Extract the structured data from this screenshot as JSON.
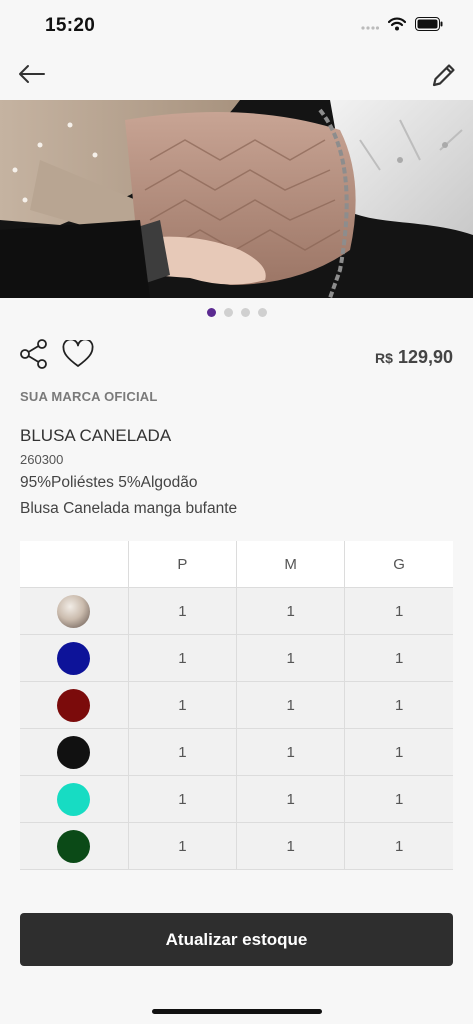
{
  "status_bar": {
    "time": "15:20",
    "icons": [
      "signal-icon",
      "wifi-icon",
      "battery-icon"
    ]
  },
  "nav": {
    "icons": [
      "back-arrow-icon",
      "edit-pencil-icon"
    ]
  },
  "carousel": {
    "page_count": 4,
    "active_index": 0
  },
  "product": {
    "price_currency": "R$",
    "price_value": "129,90",
    "brand": "SUA MARCA OFICIAL",
    "name": "BLUSA CANELADA",
    "code": "260300",
    "composition": "95%Poliéstes 5%Algodão",
    "description": "Blusa Canelada manga bufante"
  },
  "stock_table": {
    "headers": [
      "",
      "P",
      "M",
      "G"
    ],
    "rows": [
      {
        "swatch": "photo",
        "qty": [
          "1",
          "1",
          "1"
        ]
      },
      {
        "swatch": "#0d1399",
        "qty": [
          "1",
          "1",
          "1"
        ]
      },
      {
        "swatch": "#7b0b0b",
        "qty": [
          "1",
          "1",
          "1"
        ]
      },
      {
        "swatch": "#111111",
        "qty": [
          "1",
          "1",
          "1"
        ]
      },
      {
        "swatch": "#17dcc3",
        "qty": [
          "1",
          "1",
          "1"
        ]
      },
      {
        "swatch": "#0b4a17",
        "qty": [
          "1",
          "1",
          "1"
        ]
      }
    ]
  },
  "colors": {
    "accent_dot": "#5b2a91",
    "button_bg": "#2e2e2e"
  },
  "footer": {
    "update_button": "Atualizar estoque"
  }
}
